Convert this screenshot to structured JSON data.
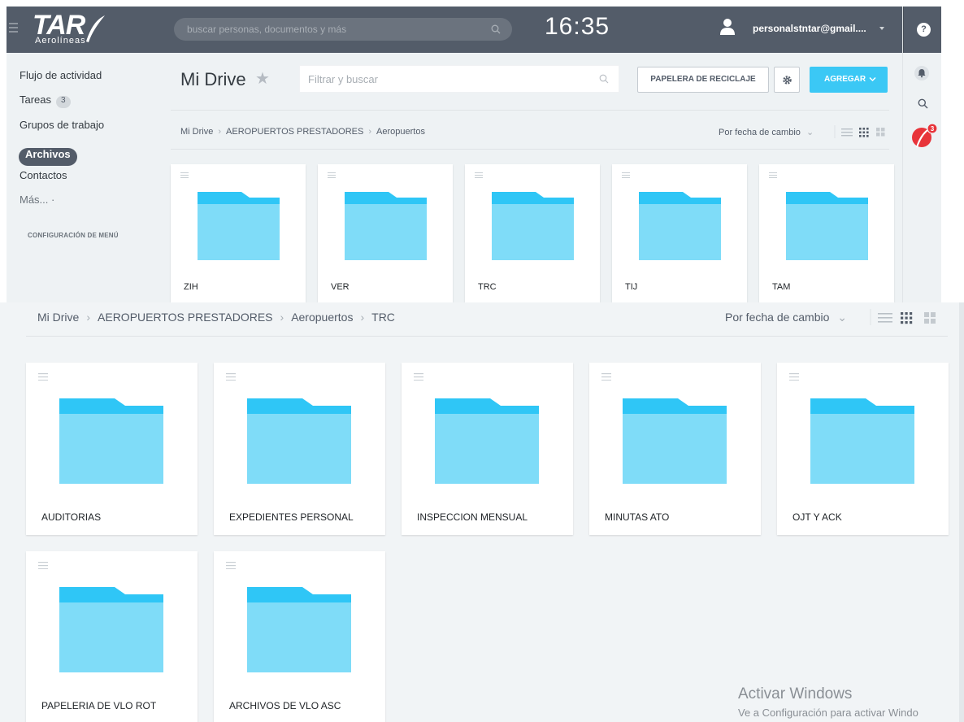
{
  "header": {
    "logo_text": "TAR",
    "logo_subtitle": "Aerolíneas",
    "search_placeholder": "buscar personas, documentos y más",
    "clock": "16:35",
    "user_email": "personalstntar@gmail....",
    "help_label": "?"
  },
  "sidebar": {
    "items": [
      {
        "label": "Flujo de actividad"
      },
      {
        "label": "Tareas",
        "badge": "3"
      },
      {
        "label": "Grupos de trabajo"
      },
      {
        "label": "Archivos",
        "active": true
      },
      {
        "label": "Contactos"
      },
      {
        "label": "Más... ·"
      }
    ],
    "config_label": "CONFIGURACIÓN DE MENÚ"
  },
  "drive": {
    "title": "Mi Drive",
    "filter_placeholder": "Filtrar y buscar",
    "trash_button": "PAPELERA DE RECICLAJE",
    "add_button": "AGREGAR",
    "breadcrumb": [
      "Mi Drive",
      "AEROPUERTOS PRESTADORES",
      "Aeropuertos"
    ],
    "sort_label": "Por fecha de cambio",
    "folders": [
      "ZIH",
      "VER",
      "TRC",
      "TIJ",
      "TAM"
    ]
  },
  "trc_view": {
    "breadcrumb": [
      "Mi Drive",
      "AEROPUERTOS PRESTADORES",
      "Aeropuertos",
      "TRC"
    ],
    "sort_label": "Por fecha de cambio",
    "folders": [
      "AUDITORIAS",
      "EXPEDIENTES PERSONAL",
      "INSPECCION MENSUAL",
      "MINUTAS ATO",
      "OJT Y ACK",
      "PAPELERIA DE VLO ROT",
      "ARCHIVOS DE VLO ASC"
    ]
  },
  "notifications": {
    "badge": "3"
  },
  "watermark": {
    "title": "Activar Windows",
    "subtitle": "Ve a Configuración para activar Windo"
  },
  "colors": {
    "header_bg": "#535c69",
    "accent": "#3bc8f5",
    "folder_tab": "#2fc6f6",
    "folder_body": "#7fdcf8",
    "badge_red": "#e8343a"
  }
}
